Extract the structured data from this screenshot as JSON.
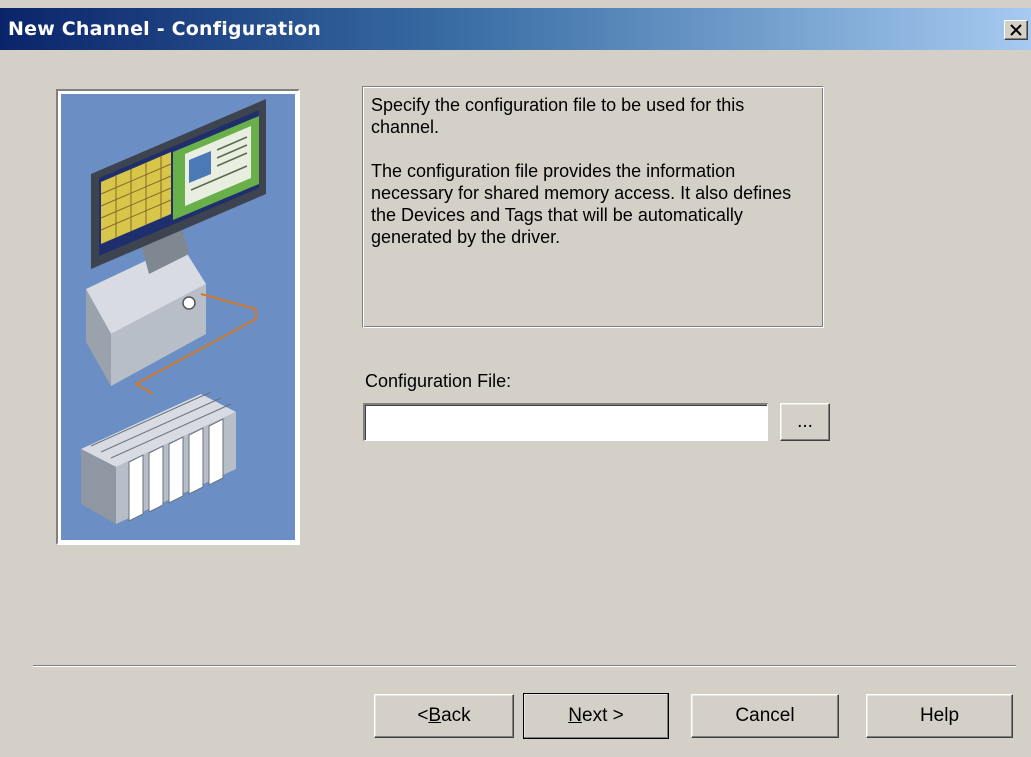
{
  "window": {
    "title": "New Channel - Configuration",
    "close_icon": "close-icon"
  },
  "description": {
    "paragraph1": "Specify the configuration file to be used for this channel.",
    "paragraph2": "The configuration file provides the information necessary for shared memory access.  It also defines the Devices and Tags that will be automatically generated by the driver."
  },
  "config_file": {
    "label": "Configuration File:",
    "value": "",
    "placeholder": "",
    "browse_label": "..."
  },
  "buttons": {
    "back_prefix": "< ",
    "back_mnemonic": "B",
    "back_rest": "ack",
    "next_mnemonic": "N",
    "next_rest": "ext >",
    "cancel": "Cancel",
    "help": "Help"
  },
  "illustration": {
    "name": "computer-plc-illustration"
  },
  "colors": {
    "face": "#d4d0c8",
    "titlebar_start": "#0a246a",
    "titlebar_end": "#a6caf0",
    "illustration_bg": "#6b8ec4"
  }
}
